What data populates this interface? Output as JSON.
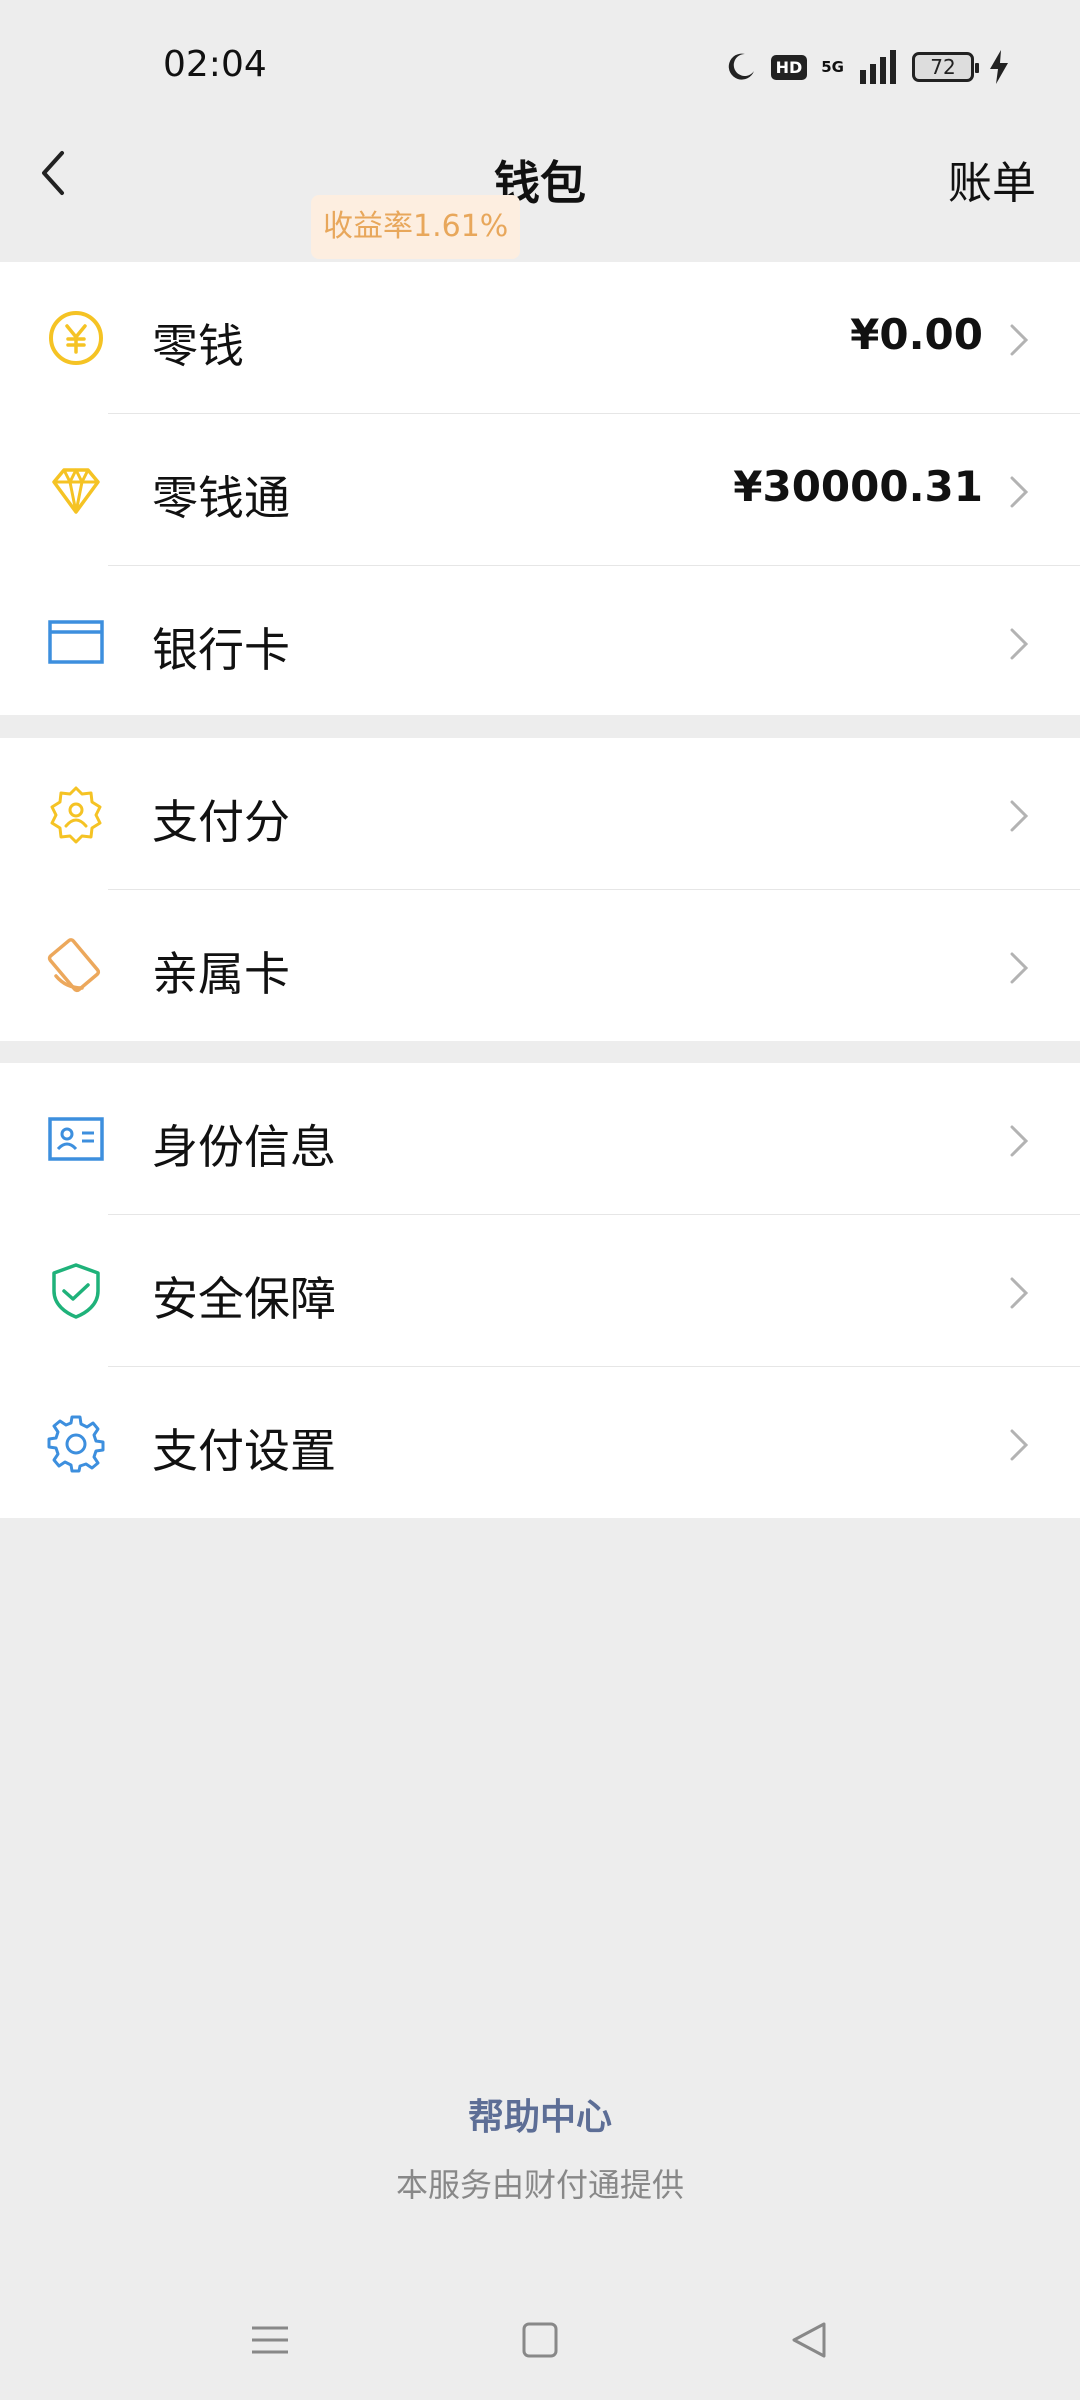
{
  "status": {
    "time": "02:04",
    "battery": "72",
    "hd": "HD",
    "network": "5G"
  },
  "nav": {
    "title": "钱包",
    "right": "账单"
  },
  "groups": [
    {
      "items": [
        {
          "label": "零钱",
          "value": "¥0.00",
          "icon": "yuan-coin-icon"
        },
        {
          "label": "零钱通",
          "badge": "收益率1.61%",
          "value": "¥30000.31",
          "icon": "diamond-icon"
        },
        {
          "label": "银行卡",
          "icon": "bank-card-icon"
        }
      ]
    },
    {
      "items": [
        {
          "label": "支付分",
          "icon": "credit-score-icon"
        },
        {
          "label": "亲属卡",
          "icon": "family-card-icon"
        }
      ]
    },
    {
      "items": [
        {
          "label": "身份信息",
          "icon": "id-card-icon"
        },
        {
          "label": "安全保障",
          "icon": "shield-check-icon"
        },
        {
          "label": "支付设置",
          "icon": "gear-icon"
        }
      ]
    }
  ],
  "footer": {
    "help": "帮助中心",
    "provider": "本服务由财付通提供"
  },
  "colors": {
    "yellow": "#f5c324",
    "orange": "#eca85c",
    "blue": "#3d8fde",
    "green": "#1fb27a",
    "link": "#5d6e96"
  }
}
